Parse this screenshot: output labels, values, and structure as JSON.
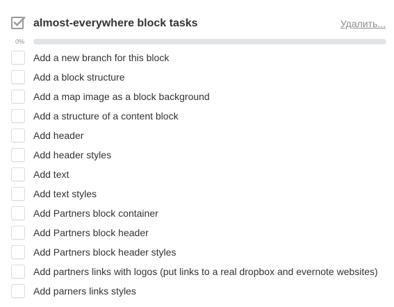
{
  "checklist": {
    "title": "almost-everywhere block tasks",
    "icon": "checkbox-checked-icon",
    "delete_label": "Удалить...",
    "progress": {
      "label": "0%",
      "percent": 0
    },
    "items": [
      {
        "label": "Add a new branch for this block",
        "checked": false
      },
      {
        "label": "Add a block structure",
        "checked": false
      },
      {
        "label": "Add a map image as a block background",
        "checked": false
      },
      {
        "label": "Add a structure of a content block",
        "checked": false
      },
      {
        "label": "Add header",
        "checked": false
      },
      {
        "label": "Add header styles",
        "checked": false
      },
      {
        "label": "Add text",
        "checked": false
      },
      {
        "label": "Add text styles",
        "checked": false
      },
      {
        "label": "Add Partners block container",
        "checked": false
      },
      {
        "label": "Add Partners block header",
        "checked": false
      },
      {
        "label": "Add Partners block header styles",
        "checked": false
      },
      {
        "label": "Add partners links with logos (put links to a real dropbox and evernote websites)",
        "checked": false
      },
      {
        "label": "Add parners links styles",
        "checked": false
      }
    ]
  },
  "colors": {
    "text": "#333333",
    "muted": "#8c8c8c",
    "progress_track": "#e2e4e6",
    "progress_fill": "#61bd4f",
    "checkbox_border": "#dcdcdc"
  }
}
